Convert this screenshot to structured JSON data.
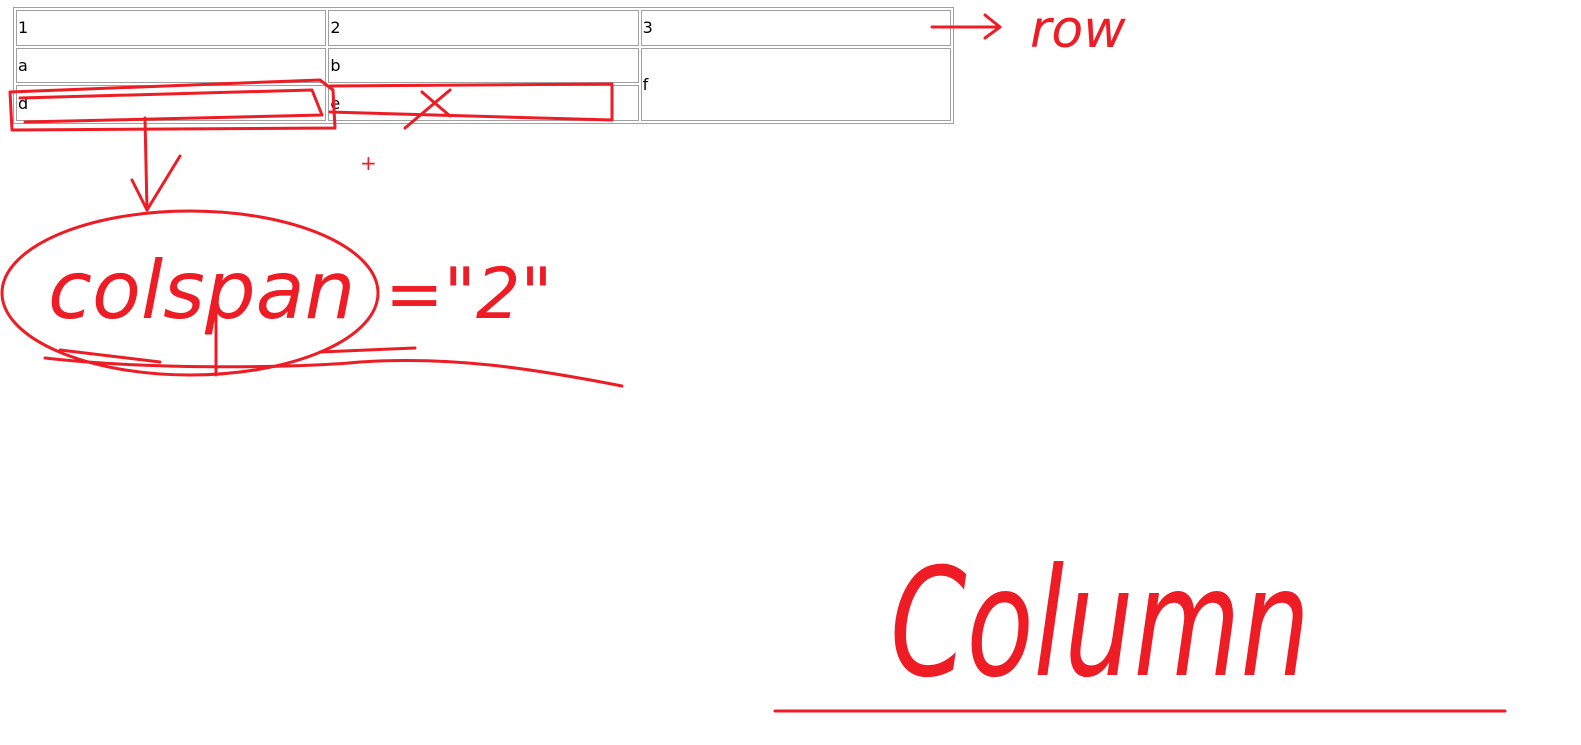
{
  "table": {
    "rows": [
      [
        "1",
        "2",
        "3"
      ],
      [
        "a",
        "b",
        "f"
      ],
      [
        "d",
        "e"
      ]
    ]
  },
  "annotations": {
    "row_label": "row",
    "colspan_label": "colspan",
    "colspan_value": "=\"2\"",
    "column_label": "Column",
    "cross_mark": "+",
    "ink_color": "#ee1c24"
  }
}
